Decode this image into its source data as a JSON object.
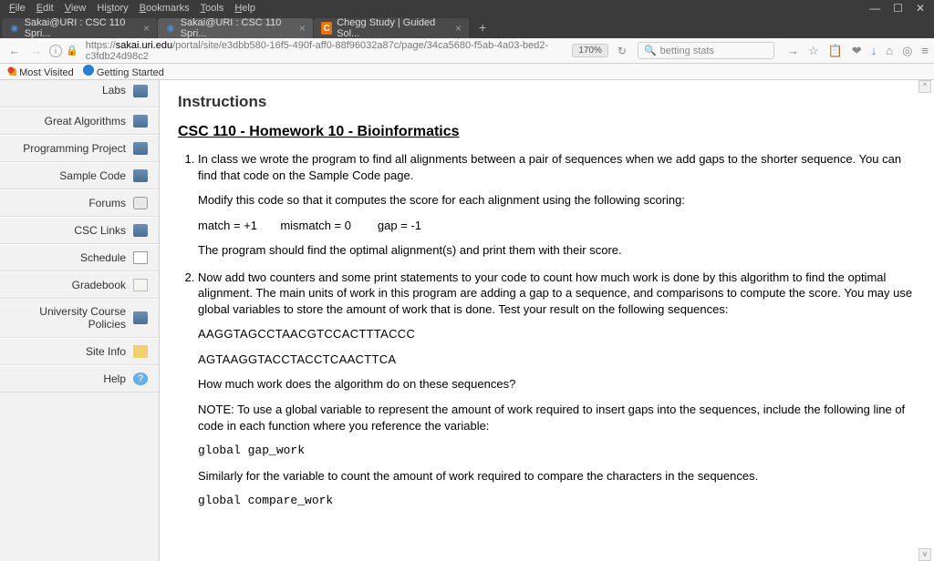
{
  "menu": [
    "File",
    "Edit",
    "View",
    "History",
    "Bookmarks",
    "Tools",
    "Help"
  ],
  "tabs": [
    {
      "icon": "sakai",
      "label": "Sakai@URI : CSC 110 Spri...",
      "active": false
    },
    {
      "icon": "sakai",
      "label": "Sakai@URI : CSC 110 Spri...",
      "active": true
    },
    {
      "icon": "chegg",
      "iconText": "C",
      "label": "Chegg Study | Guided Sol...",
      "active": false
    }
  ],
  "url": {
    "prefix": "https://",
    "domain": "sakai.uri.edu",
    "path": "/portal/site/e3dbb580-16f5-490f-aff0-88f96032a87c/page/34ca5680-f5ab-4a03-bed2-c3fdb24d98c2"
  },
  "zoom": "170%",
  "search": {
    "placeholder": "betting stats"
  },
  "bookmarks": [
    {
      "icon": "mv",
      "label": "Most Visited"
    },
    {
      "icon": "gs",
      "label": "Getting Started"
    }
  ],
  "sidebar": [
    {
      "label": "Labs",
      "icon": "book",
      "partial": true
    },
    {
      "label": "Great Algorithms",
      "icon": "book"
    },
    {
      "label": "Programming Project",
      "icon": "book"
    },
    {
      "label": "Sample Code",
      "icon": "book"
    },
    {
      "label": "Forums",
      "icon": "chat"
    },
    {
      "label": "CSC Links",
      "icon": "book"
    },
    {
      "label": "Schedule",
      "icon": "sched"
    },
    {
      "label": "Gradebook",
      "icon": "grade"
    },
    {
      "label": "University Course Policies",
      "icon": "book"
    },
    {
      "label": "Site Info",
      "icon": "folder"
    },
    {
      "label": "Help",
      "icon": "help"
    }
  ],
  "content": {
    "partialTop1": "----- -----",
    "partialTop2": "- ----- (---- -----)",
    "instructions": "Instructions",
    "title": "CSC 110 - Homework 10 - Bioinformatics",
    "li1": "In class we wrote the program to find all alignments between a pair of sequences when we add gaps to the shorter sequence.  You can find that code on the Sample Code page.",
    "p1": "Modify this code so that it computes the score for each alignment using the following scoring:",
    "scores": "match = +1       mismatch = 0        gap = -1",
    "p2": "The program should find the optimal alignment(s) and print them with their score.",
    "li2": "Now add two counters and some print statements to your code to count how much work is done by this algorithm to find the optimal alignment.  The main units of work in this program are adding a gap to a sequence, and comparisons to compute the score.  You may use global variables to store the amount of work that is done.  Test your result on the following sequences:",
    "seq1": "AAGGTAGCCTAACGTCCACTTTACCC",
    "seq2": "AGTAAGGTACCTACCTCAACTTCA",
    "q": "How much work does the algorithm do on these sequences?",
    "note": "NOTE:  To use a global variable to represent the amount of work required to insert gaps into the sequences, include the following line of code in each function where you reference the variable:",
    "code1": "global gap_work",
    "sim": "Similarly for the variable to count the amount of work required to compare the characters in the sequences.",
    "code2": "global compare_work"
  }
}
